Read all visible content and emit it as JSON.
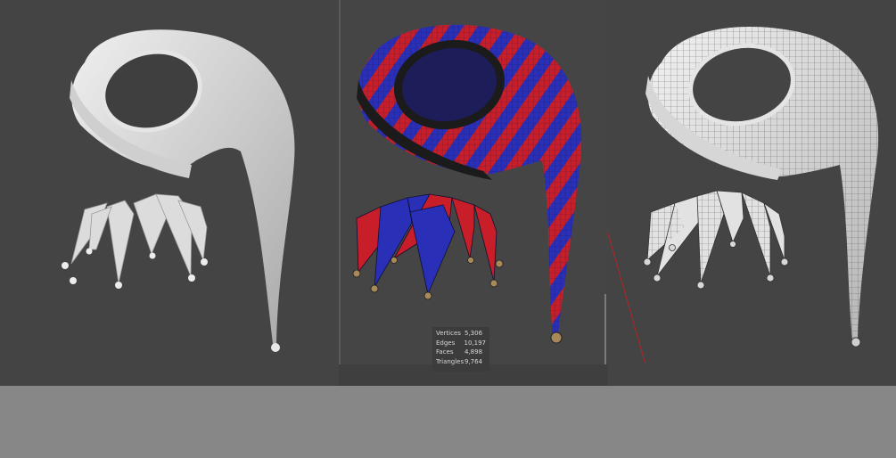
{
  "stats": {
    "rows": [
      {
        "label": "Vertices",
        "value": "5,306"
      },
      {
        "label": "Edges",
        "value": "10,197"
      },
      {
        "label": "Faces",
        "value": "4,898"
      },
      {
        "label": "Triangles",
        "value": "9,764"
      }
    ]
  },
  "colors": {
    "viewport_bg": "#444444",
    "page_bg": "#878787",
    "clay": "#d8d8d8",
    "red_stripe": "#c81e2a",
    "blue_stripe": "#2a2fb8",
    "trim": "#1b1b1b",
    "bell": "#a8895a"
  },
  "icons": [
    "jester-hat-clay-render",
    "jester-hat-uv-checker-render",
    "jester-hat-wireframe-render"
  ]
}
